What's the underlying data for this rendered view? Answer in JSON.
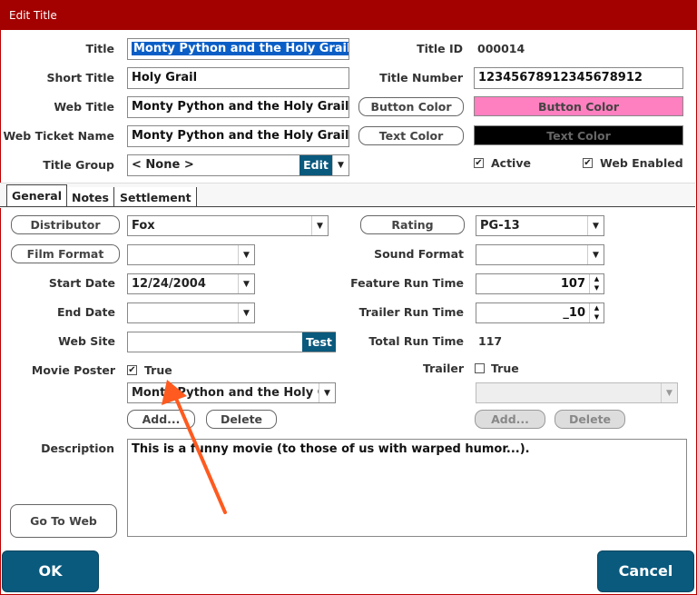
{
  "window": {
    "title": "Edit Title"
  },
  "labels": {
    "title": "Title",
    "short_title": "Short Title",
    "web_title": "Web Title",
    "web_ticket_name": "Web Ticket Name",
    "title_group": "Title Group",
    "title_id": "Title ID",
    "title_number": "Title Number",
    "start_date": "Start Date",
    "end_date": "End Date",
    "web_site": "Web Site",
    "movie_poster": "Movie Poster",
    "description": "Description",
    "sound_format": "Sound Format",
    "feature_run_time": "Feature Run Time",
    "trailer_run_time": "Trailer Run Time",
    "total_run_time": "Total Run Time",
    "trailer": "Trailer"
  },
  "values": {
    "title": "Monty Python and the Holy Grail",
    "short_title": "Holy Grail",
    "web_title": "Monty Python and the Holy Grail",
    "web_ticket_name": "Monty Python and the Holy Grail",
    "title_group": "< None >",
    "title_id": "000014",
    "title_number": "12345678912345678912",
    "distributor": "Fox",
    "rating": "PG-13",
    "film_format": "",
    "sound_format": "",
    "start_date": "12/24/2004",
    "end_date": "",
    "feature_run_time": "107",
    "trailer_run_time": "_10",
    "web_site": "",
    "total_run_time": "117",
    "movie_poster_file": "Monty Python and the Holy Gr",
    "trailer_file": "",
    "description": "This is a funny movie (to those of us with warped humor...)."
  },
  "buttons": {
    "button_color": "Button Color",
    "text_color": "Text Color",
    "edit": "Edit",
    "distributor": "Distributor",
    "rating": "Rating",
    "film_format": "Film Format",
    "test": "Test",
    "add": "Add...",
    "delete": "Delete",
    "trailer_add": "Add...",
    "trailer_delete": "Delete",
    "go_to_web": "Go To Web",
    "ok": "OK",
    "cancel": "Cancel"
  },
  "swatches": {
    "button_color_label": "Button Color",
    "button_color": "#ff80c0",
    "text_color_label": "Text Color",
    "text_color": "#000000"
  },
  "checks": {
    "active": "Active",
    "active_checked": true,
    "web_enabled": "Web Enabled",
    "web_enabled_checked": true,
    "movie_poster_true": "True",
    "movie_poster_checked": true,
    "trailer_true": "True",
    "trailer_checked": false
  },
  "tabs": [
    "General",
    "Notes",
    "Settlement"
  ],
  "icons": {
    "check": "✔",
    "dropdown": "▼",
    "spin_up": "▲",
    "spin_down": "▼"
  }
}
